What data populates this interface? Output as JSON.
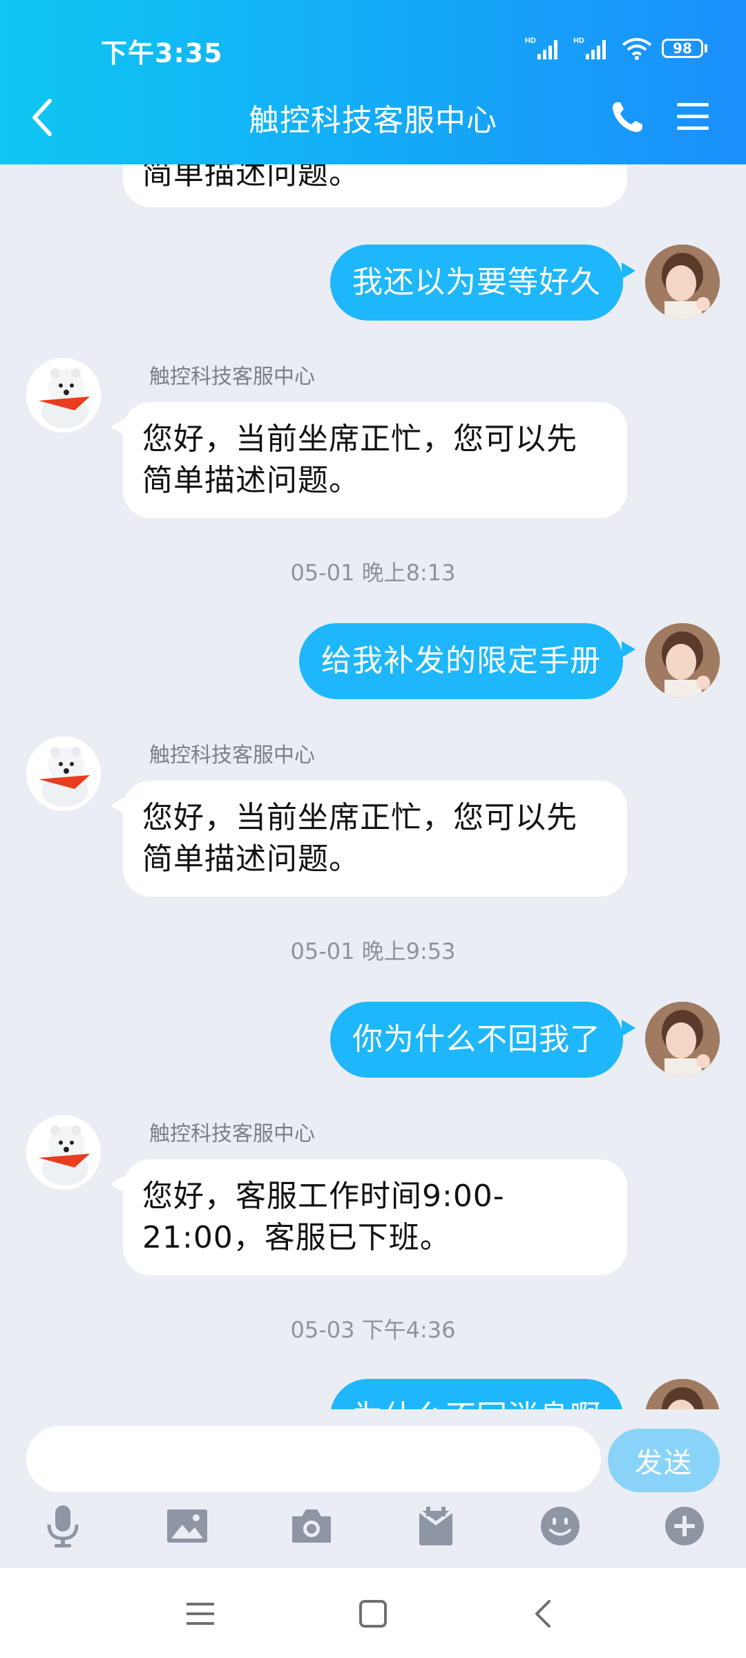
{
  "status_bar": {
    "time": "下午3:35",
    "battery": "98"
  },
  "header": {
    "title": "触控科技客服中心"
  },
  "conversation": {
    "top_partial_text": "简单描述问题。",
    "messages": [
      {
        "from": "user",
        "text": "我还以为要等好久"
      },
      {
        "from": "agent",
        "sender": "触控科技客服中心",
        "text": "您好，当前坐席正忙，您可以先简单描述问题。"
      },
      {
        "timestamp": "05-01 晚上8:13"
      },
      {
        "from": "user",
        "text": "给我补发的限定手册"
      },
      {
        "from": "agent",
        "sender": "触控科技客服中心",
        "text": "您好，当前坐席正忙，您可以先简单描述问题。"
      },
      {
        "timestamp": "05-01 晚上9:53"
      },
      {
        "from": "user",
        "text": "你为什么不回我了"
      },
      {
        "from": "agent",
        "sender": "触控科技客服中心",
        "text": "您好，客服工作时间9:00-21:00，客服已下班。"
      },
      {
        "timestamp": "05-03 下午4:36"
      },
      {
        "from": "user",
        "text": "为什么不回消息啊"
      }
    ]
  },
  "input": {
    "value": "",
    "send_label": "发送"
  },
  "toolbar": {
    "icons": [
      "microphone-icon",
      "image-icon",
      "camera-icon",
      "gift-icon",
      "emoji-icon",
      "plus-icon"
    ]
  },
  "colors": {
    "header_start": "#0fc7f2",
    "header_end": "#1b8ffb",
    "user_bubble": "#1eb7fb",
    "chat_bg": "#eaedf4",
    "send_button": "#8ad3f8"
  }
}
